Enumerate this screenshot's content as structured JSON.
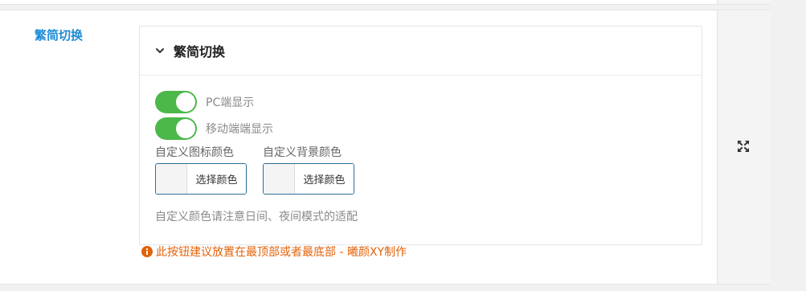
{
  "field": {
    "label": "繁简切换"
  },
  "accordion": {
    "title": "繁简切换",
    "icon": "chevron-down-icon",
    "switches": [
      {
        "label": "PC端显示",
        "on": true
      },
      {
        "label": "移动端端显示",
        "on": true
      }
    ],
    "color_fields": [
      {
        "label": "自定义图标颜色",
        "button": "选择颜色"
      },
      {
        "label": "自定义背景颜色",
        "button": "选择颜色"
      }
    ],
    "note": "自定义颜色请注意日间、夜间模式的适配"
  },
  "hint": {
    "icon": "info-icon",
    "text": "此按钮建议放置在最顶部或者最底部 - 曦颜XY制作"
  },
  "side": {
    "icon": "expand-icon"
  },
  "colors": {
    "switch_on": "#4cb849",
    "label_blue": "#1e8cd6",
    "hint_orange": "#e36209",
    "picker_border": "#2f6d97"
  }
}
